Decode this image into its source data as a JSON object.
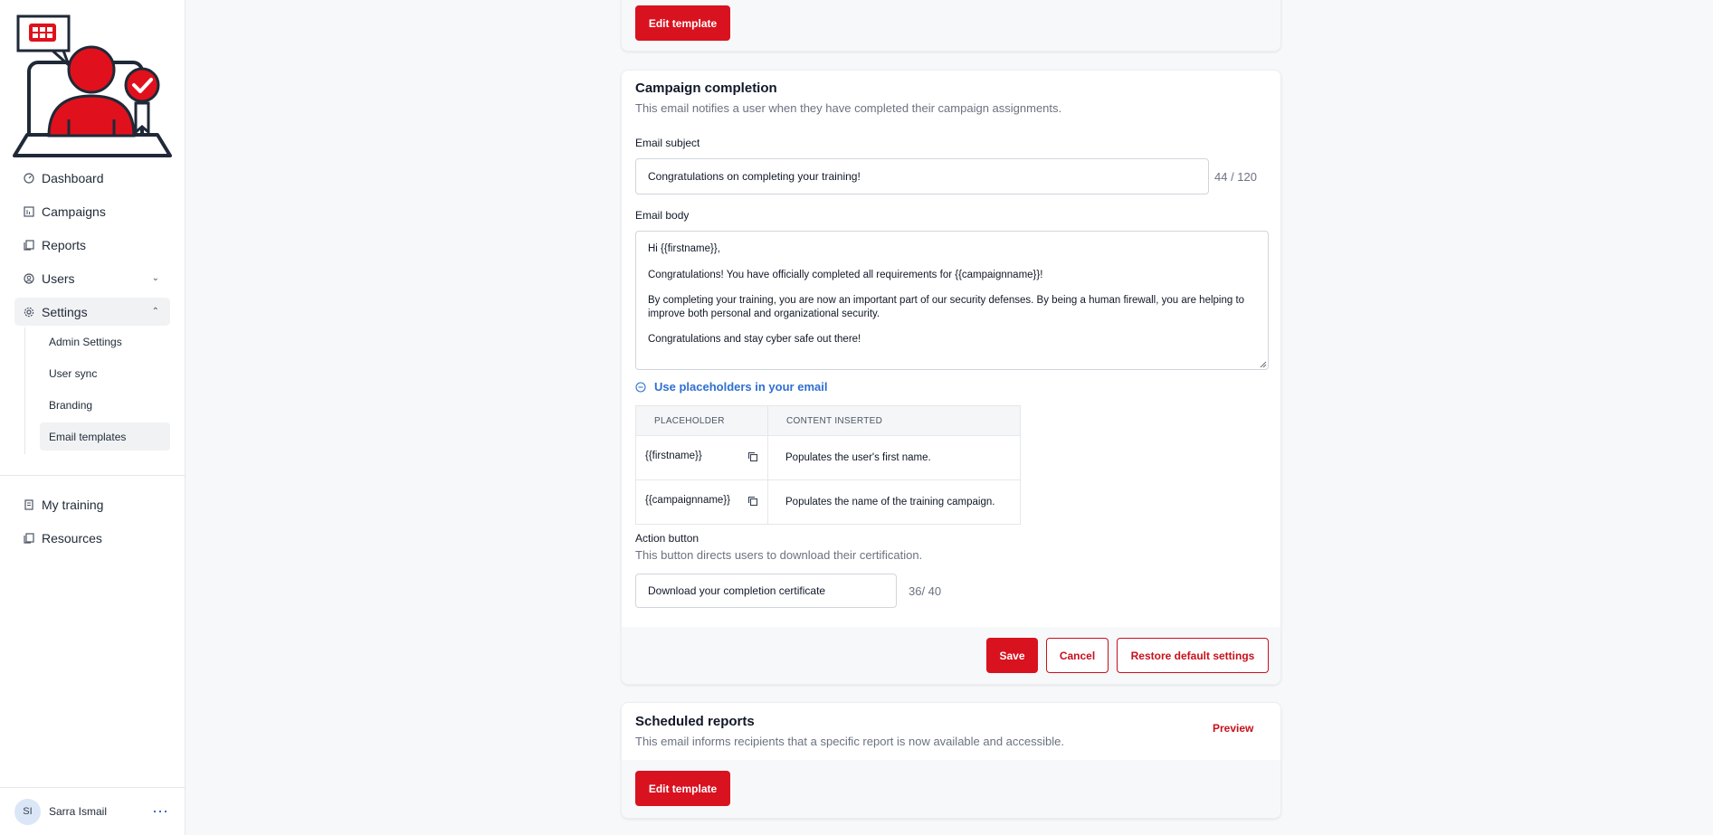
{
  "sidebar": {
    "nav": [
      {
        "label": "Dashboard",
        "icon": "dashboard-icon"
      },
      {
        "label": "Campaigns",
        "icon": "campaigns-icon"
      },
      {
        "label": "Reports",
        "icon": "reports-icon"
      },
      {
        "label": "Users",
        "icon": "users-icon"
      },
      {
        "label": "Settings",
        "icon": "settings-icon"
      }
    ],
    "settings_sub": [
      {
        "label": "Admin Settings"
      },
      {
        "label": "User sync"
      },
      {
        "label": "Branding"
      },
      {
        "label": "Email templates"
      }
    ],
    "bottom_nav": [
      {
        "label": "My training",
        "icon": "training-icon"
      },
      {
        "label": "Resources",
        "icon": "resources-icon"
      }
    ],
    "user": {
      "initials": "SI",
      "name": "Sarra Ismail"
    }
  },
  "top_card": {
    "edit_label": "Edit template"
  },
  "completion": {
    "title": "Campaign completion",
    "description": "This email notifies a user when they have completed their campaign assignments.",
    "subject_label": "Email subject",
    "subject_value": "Congratulations on completing your training!",
    "subject_counter": "44 / 120",
    "body_label": "Email body",
    "body_lines": [
      "Hi {{firstname}},",
      "Congratulations! You have officially completed all requirements for {{campaignname}}!",
      "By completing your training, you are now an important part of our security defenses. By being a human firewall, you are helping to improve both personal and organizational security.",
      "Congratulations and stay cyber safe out there!"
    ],
    "placeholders_toggle": "Use placeholders in your email",
    "table_headers": [
      "PLACEHOLDER",
      "CONTENT INSERTED"
    ],
    "table_rows": [
      {
        "placeholder": "{{firstname}}",
        "content": "Populates the user's first name."
      },
      {
        "placeholder": "{{campaignname}}",
        "content": "Populates the name of the training campaign."
      }
    ],
    "action_label": "Action button",
    "action_description": "This button directs users to download their certification.",
    "action_value": "Download your completion certificate",
    "action_counter": "36/ 40",
    "save_label": "Save",
    "cancel_label": "Cancel",
    "restore_label": "Restore default settings"
  },
  "scheduled": {
    "title": "Scheduled reports",
    "description": "This email informs recipients that a specific report is now available and accessible.",
    "preview_label": "Preview",
    "edit_label": "Edit template"
  },
  "colors": {
    "brand_red": "#d9121f",
    "link_blue": "#2f6fd0"
  }
}
